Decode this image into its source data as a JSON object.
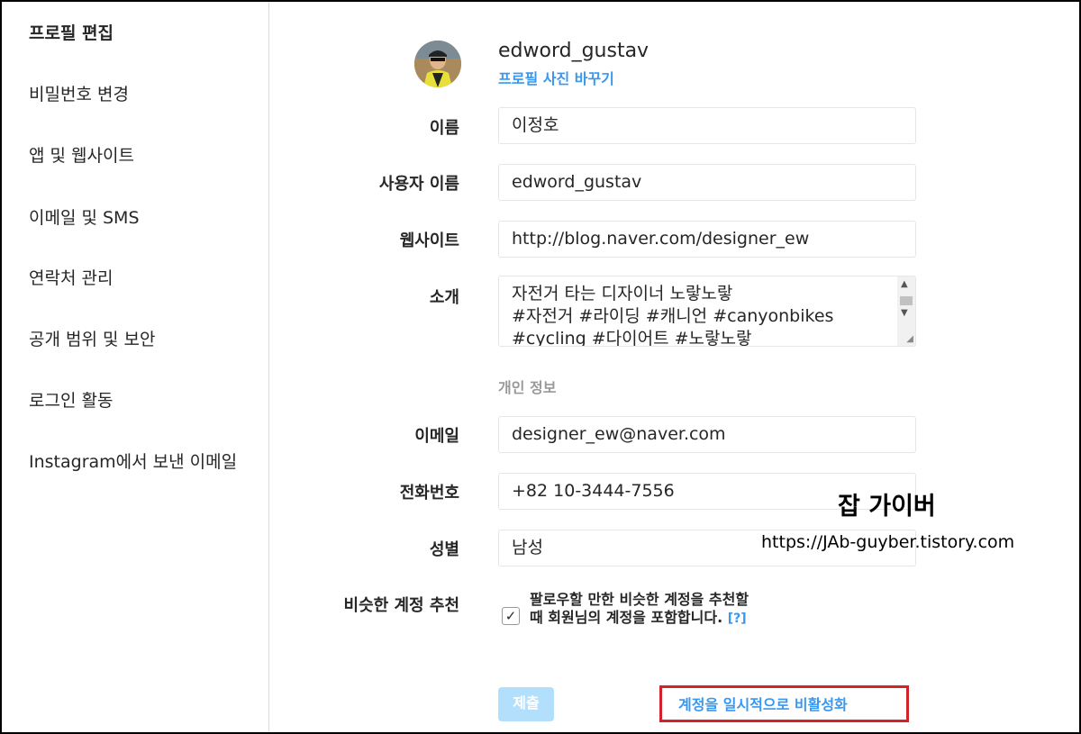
{
  "sidebar": {
    "items": [
      {
        "label": "프로필 편집",
        "active": true
      },
      {
        "label": "비밀번호 변경",
        "active": false
      },
      {
        "label": "앱 및 웹사이트",
        "active": false
      },
      {
        "label": "이메일 및 SMS",
        "active": false
      },
      {
        "label": "연락처 관리",
        "active": false
      },
      {
        "label": "공개 범위 및 보안",
        "active": false
      },
      {
        "label": "로그인 활동",
        "active": false
      },
      {
        "label": "Instagram에서 보낸 이메일",
        "active": false
      }
    ]
  },
  "profile": {
    "username": "edword_gustav",
    "change_photo": "프로필 사진 바꾸기"
  },
  "form": {
    "name_label": "이름",
    "name_value": "이정호",
    "username_label": "사용자 이름",
    "username_value": "edword_gustav",
    "website_label": "웹사이트",
    "website_value": "http://blog.naver.com/designer_ew",
    "bio_label": "소개",
    "bio_lines": [
      "자전거 타는 디자이너 노랗노랗",
      "#자전거 #라이딩 #캐니언 #canyonbikes",
      "#cycling #다이어트 #노랗노랗"
    ],
    "private_section": "개인 정보",
    "email_label": "이메일",
    "email_value": "designer_ew@naver.com",
    "phone_label": "전화번호",
    "phone_value": "+82 10-3444-7556",
    "gender_label": "성별",
    "gender_value": "남성",
    "similar_label": "비슷한 계정 추천",
    "similar_checked": true,
    "similar_desc": "팔로우할 만한 비슷한 계정을 추천할 때 회원님의 계정을 포함합니다.",
    "help_link": "[?]",
    "submit": "제출",
    "disable": "계정을 일시적으로 비활성화"
  },
  "watermark": {
    "title": "잡 가이버",
    "url": "https://JAb-guyber.tistory.com"
  },
  "colors": {
    "link": "#3897f0",
    "submit_disabled": "#b2dffc",
    "highlight_border": "#d2232a"
  }
}
